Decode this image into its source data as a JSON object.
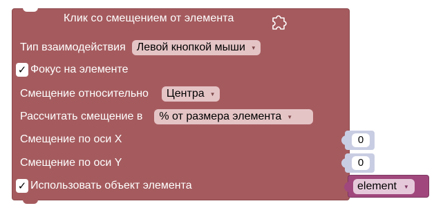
{
  "block": {
    "title": "Клик со смещением от элемента",
    "interaction_label": "Тип взаимодействия",
    "interaction_value": "Левой кнопкой мыши",
    "focus_checked": "✓",
    "focus_label": "Фокус на элементе",
    "offset_relative_label": "Смещение относительно",
    "offset_relative_value": "Центра",
    "calc_offset_label": "Рассчитать смещение в",
    "calc_offset_value": "% от размера элемента",
    "offset_x_label": "Смещение по оси X",
    "offset_x_value": "0",
    "offset_y_label": "Смещение по оси Y",
    "offset_y_value": "0",
    "use_element_checked": "✓",
    "use_element_label": "Использовать объект элемента",
    "element_value": "element"
  },
  "icons": {
    "puzzle": "puzzle-icon",
    "dropdown": "dropdown-arrow-icon",
    "check": "checkmark-icon"
  },
  "colors": {
    "block": "#a55b5e",
    "dropdown": "#e5c4c6",
    "socket": "#c9cde3",
    "element_block": "#a0487d"
  }
}
